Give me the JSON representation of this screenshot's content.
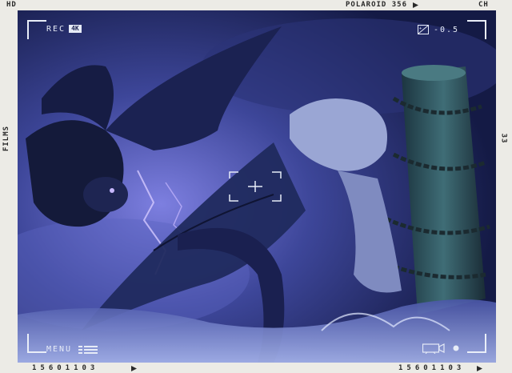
{
  "frame": {
    "top_left": "HD",
    "top_center": "POLAROID 356",
    "top_right": "CH",
    "left_side": "FILMS",
    "right_side": "33",
    "bottom_left_code": "15601103",
    "bottom_right_code": "15601103"
  },
  "hud": {
    "rec_label": "REC",
    "quality_badge": "4K",
    "exposure_value": "-0.5",
    "menu_label": "MENU"
  },
  "colors": {
    "sky_dark": "#1a2150",
    "sky_light": "#6a76c9",
    "lightning": "#c7b8ff",
    "dragon_left": "#141a3a",
    "dragon_right": "#9aa6d4",
    "pillar": "#2f5560",
    "water": "#8fa0dc",
    "hud": "#e6ebf7"
  },
  "icons": [
    "play-icon",
    "exposure-icon",
    "focus-reticle-icon",
    "menu-lines-icon",
    "camera-icon",
    "record-dot-icon"
  ]
}
